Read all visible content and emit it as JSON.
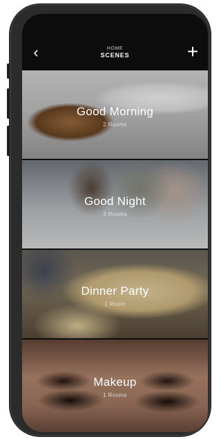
{
  "header": {
    "breadcrumb": "HOME",
    "title": "SCENES",
    "back_icon": "chevron-left-icon",
    "add_icon": "plus-icon",
    "back_glyph": "‹",
    "add_glyph": "+"
  },
  "scenes": [
    {
      "name": "Good Morning",
      "rooms": "2 Rooms"
    },
    {
      "name": "Good Night",
      "rooms": "3 Rooms"
    },
    {
      "name": "Dinner Party",
      "rooms": "1 Room"
    },
    {
      "name": "Makeup",
      "rooms": "1 Rooms"
    }
  ],
  "colors": {
    "screen_bg": "#0c0c0c",
    "text": "#ffffff",
    "frame": "#2b2b2b"
  }
}
